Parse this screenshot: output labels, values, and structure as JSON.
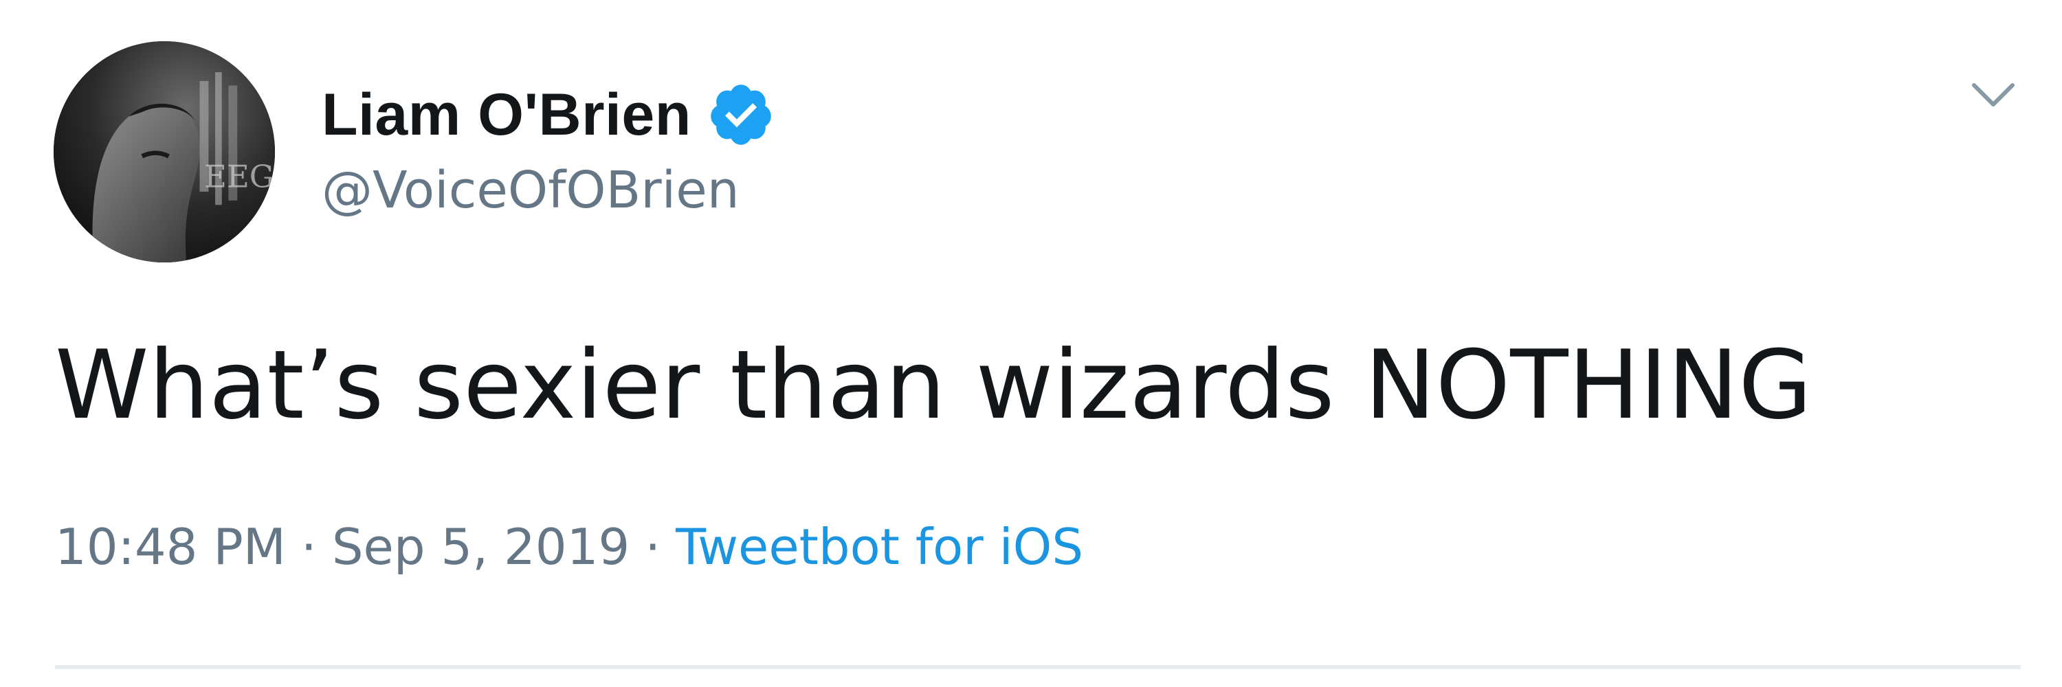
{
  "tweet": {
    "author": {
      "display_name": "Liam O'Brien",
      "handle": "@VoiceOfOBrien",
      "verified": true,
      "avatar_icon": "user-avatar-photo"
    },
    "text": "What’s sexier than wizards NOTHING",
    "time": "10:48 PM",
    "separator": "·",
    "date": "Sep 5, 2019",
    "source": "Tweetbot for iOS",
    "menu_icon": "chevron-down-icon"
  },
  "colors": {
    "text_primary": "#14171a",
    "text_secondary": "#657786",
    "link": "#1b95e0",
    "verified_badge": "#1da1f2",
    "divider": "#e6ecf0"
  }
}
